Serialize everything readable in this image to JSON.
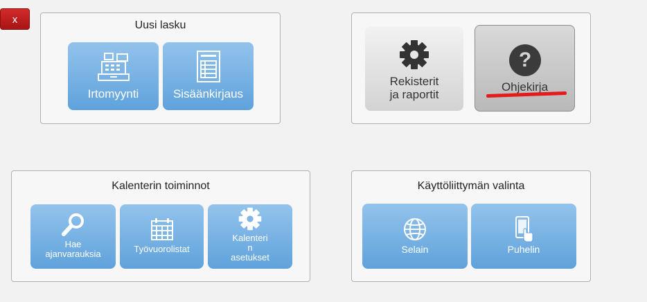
{
  "close_button": {
    "label": "x"
  },
  "panels": {
    "new_invoice": {
      "title": "Uusi lasku",
      "tiles": [
        {
          "label": "Irtomyynti",
          "icon": "cash-register-icon"
        },
        {
          "label": "Sisäänkirjaus",
          "icon": "document-list-icon"
        }
      ]
    },
    "registers": {
      "tiles": [
        {
          "label_line1": "Rekisterit",
          "label_line2": "ja raportit",
          "icon": "gear-icon"
        },
        {
          "label": "Ohjekirja",
          "icon": "help-icon"
        }
      ]
    },
    "calendar": {
      "title": "Kalenterin toiminnot",
      "tiles": [
        {
          "label_line1": "Hae",
          "label_line2": "ajanvarauksia",
          "icon": "search-icon"
        },
        {
          "label": "Työvuorolistat",
          "icon": "calendar-icon"
        },
        {
          "label_line1": "Kalenteri",
          "label_line2": "n",
          "label_line3": "asetukset",
          "icon": "gear-icon"
        }
      ]
    },
    "ui_choice": {
      "title": "Käyttöliittymän valinta",
      "tiles": [
        {
          "label": "Selain",
          "icon": "globe-icon"
        },
        {
          "label": "Puhelin",
          "icon": "phone-touch-icon"
        }
      ]
    }
  },
  "colors": {
    "tile_blue": "#6aa9de",
    "close_red": "#c11f1f",
    "underline_red": "#e31b1b"
  }
}
